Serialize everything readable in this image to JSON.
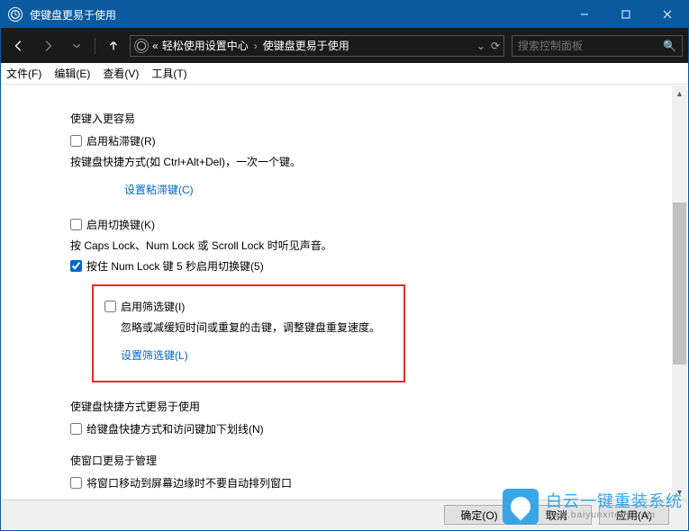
{
  "window": {
    "title": "使键盘更易于使用"
  },
  "titlebar_controls": {
    "min": "minimize",
    "max": "maximize",
    "close": "close"
  },
  "nav": {
    "breadcrumb_prefix": "«",
    "breadcrumb_parent": "轻松使用设置中心",
    "breadcrumb_sep": "›",
    "breadcrumb_current": "使键盘更易于使用",
    "search_placeholder": "搜索控制面板"
  },
  "menu": {
    "file": "文件(F)",
    "edit": "编辑(E)",
    "view": "查看(V)",
    "tools": "工具(T)"
  },
  "sections": {
    "s1_title": "使键入更容易",
    "sticky_label": "启用粘滞键(R)",
    "sticky_desc": "按键盘快捷方式(如 Ctrl+Alt+Del)，一次一个键。",
    "sticky_link": "设置粘滞键(C)",
    "toggle_label": "启用切换键(K)",
    "toggle_desc": "按 Caps Lock、Num Lock 或 Scroll Lock 时听见声音。",
    "toggle_sub_label": "按住 Num Lock 键 5 秒启用切换键(5)",
    "filter_label": "启用筛选键(I)",
    "filter_desc": "忽略或减缓短时间或重复的击键，调整键盘重复速度。",
    "filter_link": "设置筛选键(L)",
    "s2_title": "使键盘快捷方式更易于使用",
    "underline_label": "给键盘快捷方式和访问键加下划线(N)",
    "s3_title": "使窗口更易于管理",
    "arrange_label": "将窗口移动到屏幕边缘时不要自动排列窗口"
  },
  "footer": {
    "ok": "确定(O)",
    "cancel": "取消",
    "apply": "应用(A)"
  },
  "watermark": {
    "line1": "白云一键重装系统",
    "line2": "www.baiyunxitong.com"
  }
}
